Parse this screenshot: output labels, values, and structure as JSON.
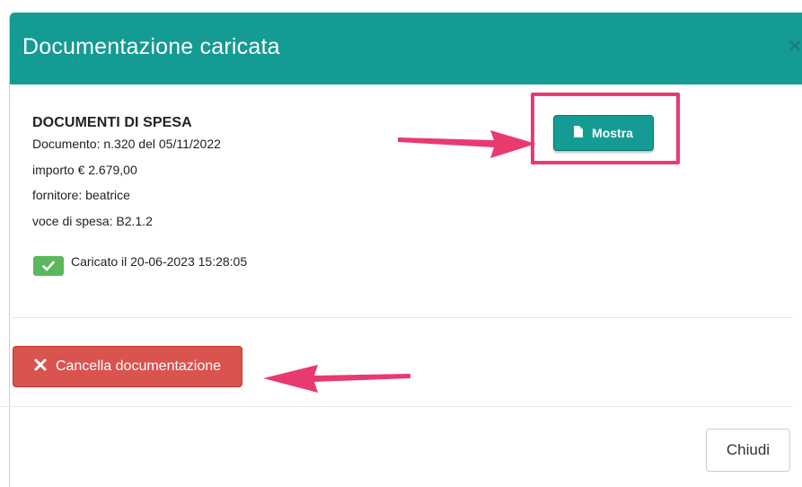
{
  "modal": {
    "title": "Documentazione caricata",
    "close_symbol": "×"
  },
  "document": {
    "heading": "DOCUMENTI DI SPESA",
    "number_line": "Documento: n.320 del 05/11/2022",
    "amount_line": "importo € 2.679,00",
    "supplier_line": "fornitore: beatrice",
    "expense_line": "voce di spesa: B2.1.2",
    "status_text": "Caricato il 20-06-2023 15:28:05"
  },
  "buttons": {
    "show_label": "Mostra",
    "delete_label": "Cancella documentazione",
    "close_label": "Chiudi"
  },
  "colors": {
    "header": "#149b93",
    "annotation": "#e93a6f",
    "success": "#5cb85c",
    "danger": "#d9534f"
  },
  "icons": [
    "file-icon",
    "check-icon",
    "times-icon",
    "close-icon"
  ]
}
